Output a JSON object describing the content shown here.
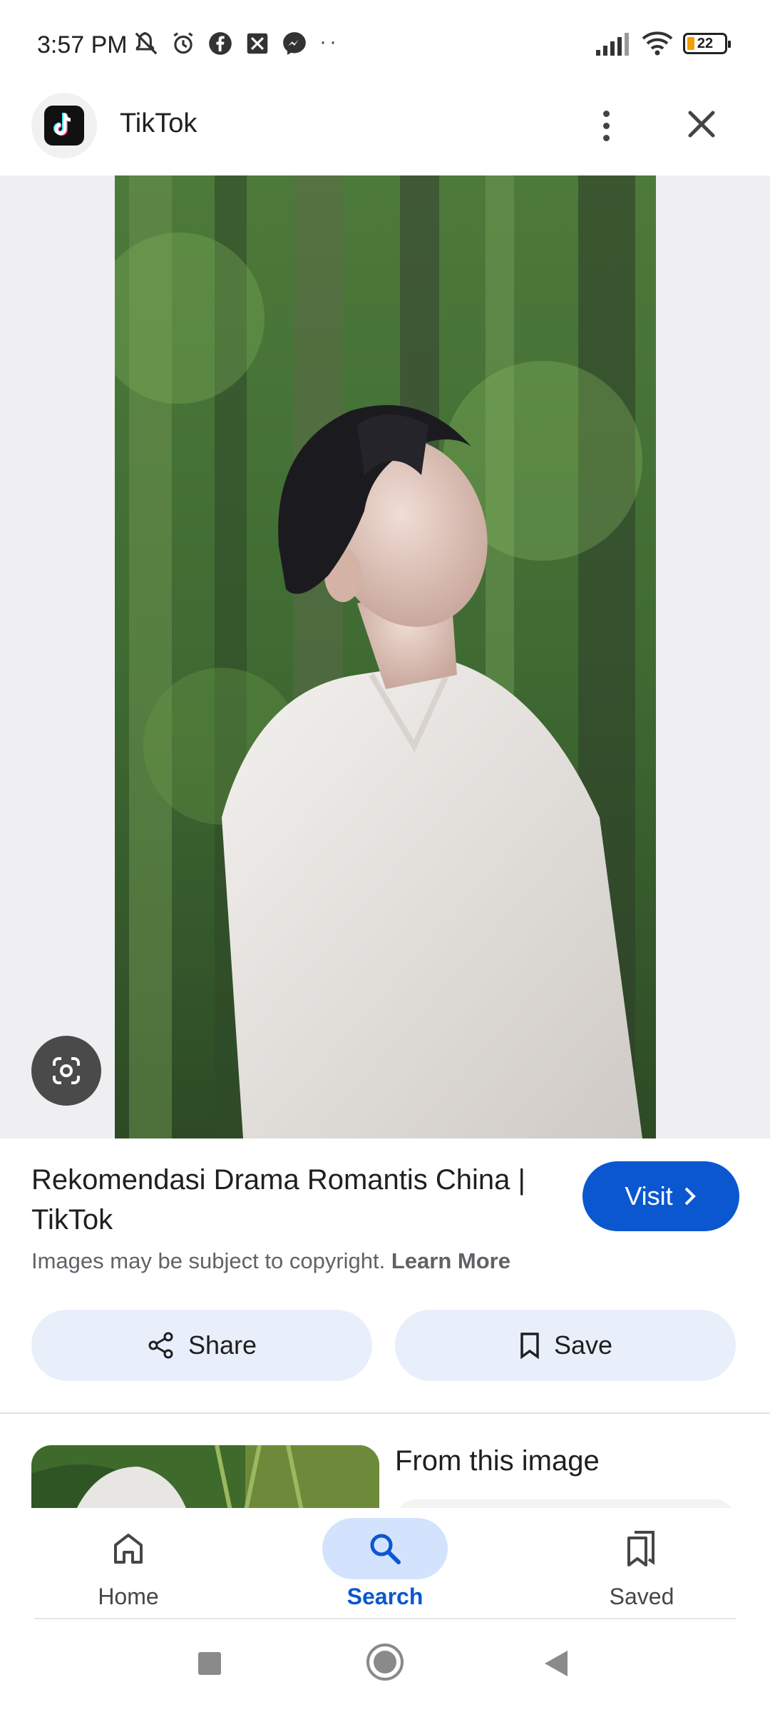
{
  "status_bar": {
    "time": "3:57 PM",
    "left_icons": [
      "mute-bell-icon",
      "alarm-icon",
      "facebook-icon",
      "vpn-icon",
      "messenger-icon"
    ],
    "more_dots": "··",
    "battery": "22",
    "battery_color": "#f2a100"
  },
  "header": {
    "app_name": "TikTok",
    "app_icon": "tiktok-logo-icon"
  },
  "result": {
    "title": "Rekomendasi Drama Romantis China | TikTok",
    "visit_label": "Visit",
    "copyright_text": "Images may be subject to copyright.",
    "learn_more": "Learn More",
    "share_label": "Share",
    "save_label": "Save"
  },
  "related": {
    "title": "From this image"
  },
  "bottom_nav": {
    "items": [
      {
        "label": "Home",
        "icon": "home-icon"
      },
      {
        "label": "Search",
        "icon": "search-icon",
        "active": true
      },
      {
        "label": "Saved",
        "icon": "saved-icon"
      }
    ]
  },
  "colors": {
    "accent": "#0b57d0",
    "pill_bg": "#e9eefb",
    "active_nav": "#d3e3fd"
  }
}
